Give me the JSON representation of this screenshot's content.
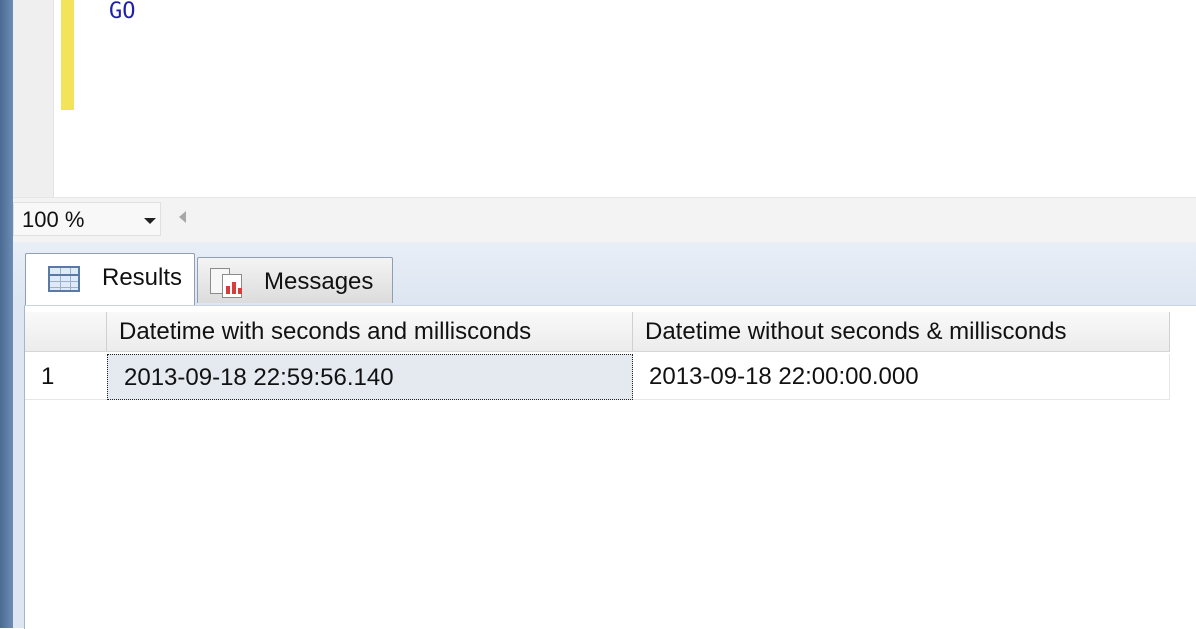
{
  "editor": {
    "code_line": "GO"
  },
  "zoom": {
    "value": "100 %"
  },
  "tabs": [
    {
      "label": "Results",
      "icon": "grid-icon"
    },
    {
      "label": "Messages",
      "icon": "messages-icon"
    }
  ],
  "grid": {
    "columns": [
      "Datetime with seconds and millisconds",
      "Datetime without seconds & millisconds"
    ],
    "rows": [
      {
        "num": "1",
        "cells": [
          "2013-09-18 22:59:56.140",
          "2013-09-18 22:00:00.000"
        ]
      }
    ]
  },
  "colors": {
    "keyword": "#1f1fa8",
    "change_bar": "#f2e35a",
    "panel": "#dde6f2"
  }
}
